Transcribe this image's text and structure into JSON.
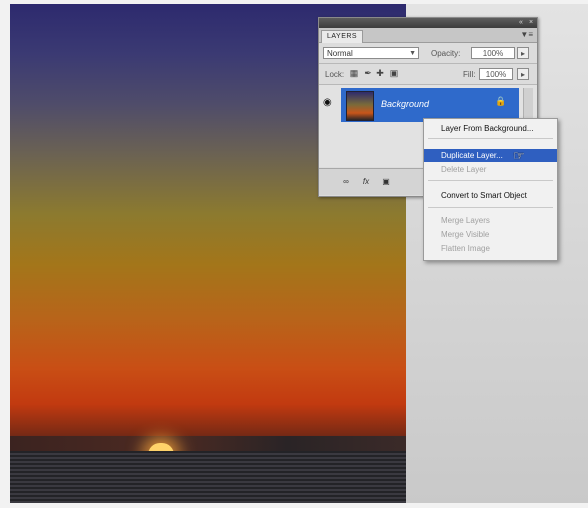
{
  "layers_panel": {
    "tab_label": "LAYERS",
    "menu_icon": "panel-menu-icon",
    "blend_mode": "Normal",
    "opacity_label": "Opacity:",
    "opacity_value": "100%",
    "lock_label": "Lock:",
    "fill_label": "Fill:",
    "fill_value": "100%",
    "layers": [
      {
        "name": "Background",
        "selected": true,
        "visible": true,
        "locked": true
      }
    ],
    "footer_icons": [
      "link-icon",
      "fx-icon",
      "mask-icon"
    ]
  },
  "context_menu": {
    "items": [
      {
        "label": "Layer From Background...",
        "disabled": false,
        "highlighted": false
      },
      {
        "label": "Duplicate Layer...",
        "disabled": false,
        "highlighted": true
      },
      {
        "label": "Delete Layer",
        "disabled": true,
        "highlighted": false
      },
      {
        "label": "Convert to Smart Object",
        "disabled": false,
        "highlighted": false
      },
      {
        "label": "Merge Layers",
        "disabled": true,
        "highlighted": false
      },
      {
        "label": "Merge Visible",
        "disabled": true,
        "highlighted": false
      },
      {
        "label": "Flatten Image",
        "disabled": true,
        "highlighted": false
      }
    ]
  },
  "colors": {
    "selection_blue": "#2f6acb",
    "menu_highlight": "#2f5fc0"
  }
}
